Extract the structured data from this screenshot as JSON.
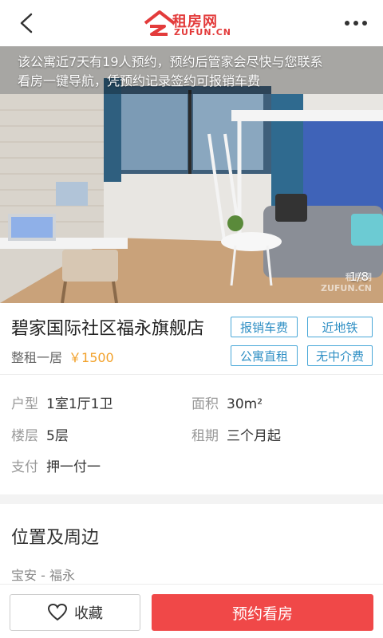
{
  "header": {
    "logo_cn": "租房网",
    "logo_en": "ZUFUN.CN",
    "back_icon": "chevron-left-icon",
    "more_icon": "more-dots-icon"
  },
  "hero": {
    "notice_line1": "该公寓近7天有19人预约，预约后管家会尽快与您联系",
    "notice_line2": "看房一键导航，凭预约记录签约可报销车费",
    "counter": "1/8",
    "watermark_cn": "租房网",
    "watermark": "ZUFUN.CN"
  },
  "listing": {
    "title": "碧家国际社区福永旗舰店",
    "type": "整租一居",
    "price": "￥1500",
    "tags": [
      "报销车费",
      "近地铁",
      "公寓直租",
      "无中介费"
    ]
  },
  "details": {
    "layout_label": "户型",
    "layout_value": "1室1厅1卫",
    "area_label": "面积",
    "area_value": "30m²",
    "floor_label": "楼层",
    "floor_value": "5层",
    "term_label": "租期",
    "term_value": "三个月起",
    "pay_label": "支付",
    "pay_value": "押一付一"
  },
  "location": {
    "title": "位置及周边",
    "area": "宝安 - 福永"
  },
  "actions": {
    "favorite_label": "收藏",
    "book_label": "预约看房"
  },
  "colors": {
    "brand_red": "#e33b3b",
    "tag_blue": "#2f8fc4",
    "price_orange": "#f2a12a",
    "book_button": "#f04848"
  }
}
